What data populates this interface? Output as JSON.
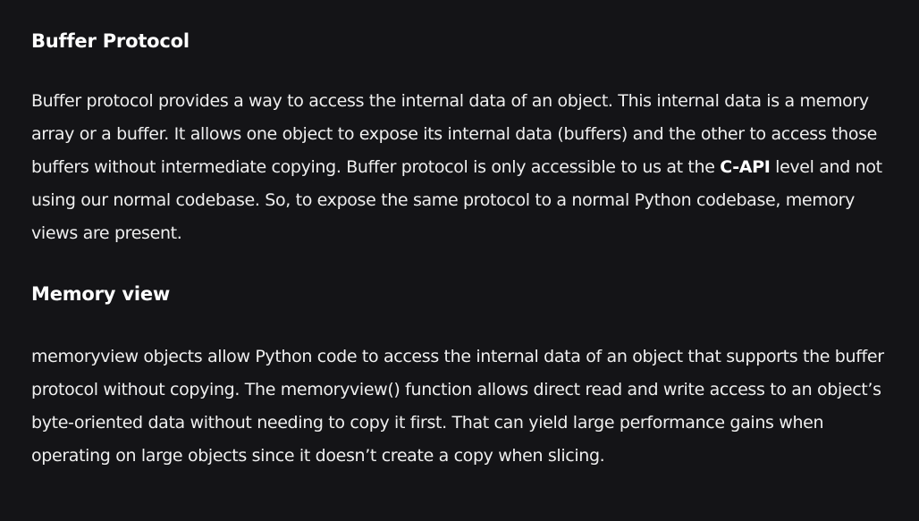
{
  "sections": [
    {
      "heading": "Buffer Protocol",
      "paragraph": {
        "part1": "Buffer protocol provides a way to access the internal data of an object. This internal data is a memory array or a buffer. It allows one object to expose its internal data (buffers) and the other to access those buffers without intermediate copying. Buffer protocol is only accessible to us at the ",
        "emphasis": "C-API",
        "part2": " level and not using our normal codebase. So, to expose the same protocol to a normal Python codebase, memory views are present."
      }
    },
    {
      "heading": "Memory view",
      "paragraph": "memoryview objects allow Python code to access the internal data of an object that supports the buffer protocol without copying. The memoryview() function allows direct read and write access to an object’s byte-oriented data without needing to copy it first. That can yield large performance gains when operating on large objects since it doesn’t create a copy when slicing."
    }
  ]
}
